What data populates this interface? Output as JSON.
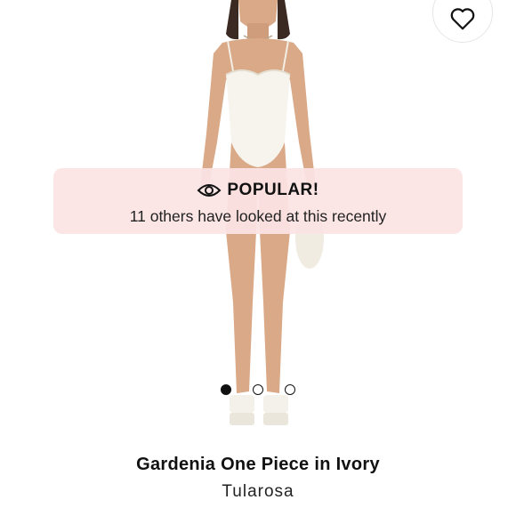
{
  "product": {
    "name": "Gardenia One Piece in Ivory",
    "brand": "Tularosa"
  },
  "badge": {
    "title": "POPULAR!",
    "message": "11 others have looked at this recently",
    "icon": "eye-icon",
    "background": "#fbe3e3"
  },
  "carousel": {
    "slides": 3,
    "active_index": 0
  },
  "wishlist": {
    "icon": "heart-outline-icon"
  }
}
